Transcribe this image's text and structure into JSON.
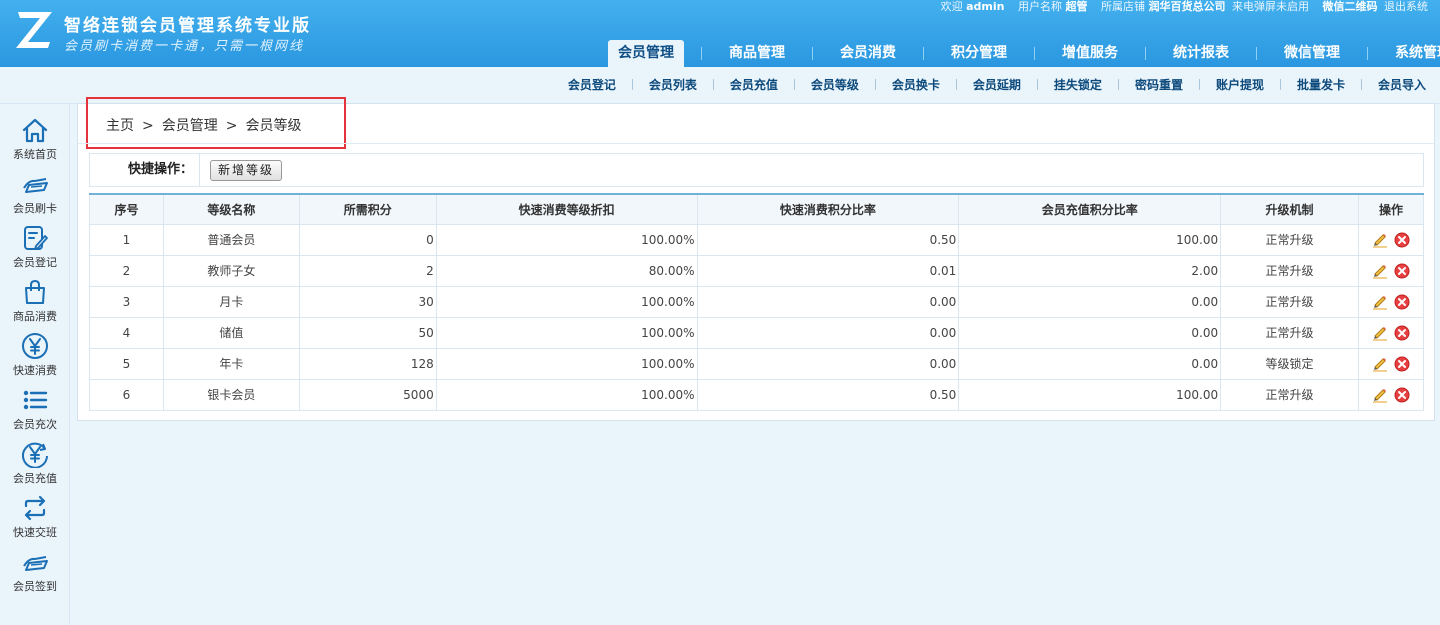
{
  "app": {
    "title": "智络连锁会员管理系统专业版",
    "slogan": "会员刷卡消费一卡通，只需一根网线"
  },
  "user_bar": {
    "welcome": "欢迎",
    "username": "admin",
    "user_name_label": "用户名称",
    "user_role": "超管",
    "store_label": "所属店铺",
    "store_name": "润华百货总公司",
    "popup_status": "来电弹屏未启用",
    "wechat_qr": "微信二维码",
    "logout": "退出系统"
  },
  "main_nav": [
    {
      "label": "会员管理",
      "active": true
    },
    {
      "label": "商品管理",
      "active": false
    },
    {
      "label": "会员消费",
      "active": false
    },
    {
      "label": "积分管理",
      "active": false
    },
    {
      "label": "增值服务",
      "active": false
    },
    {
      "label": "统计报表",
      "active": false
    },
    {
      "label": "微信管理",
      "active": false
    },
    {
      "label": "系统管理",
      "active": false
    }
  ],
  "sub_nav": [
    "会员登记",
    "会员列表",
    "会员充值",
    "会员等级",
    "会员换卡",
    "会员延期",
    "挂失锁定",
    "密码重置",
    "账户提现",
    "批量发卡",
    "会员导入"
  ],
  "sidebar": [
    {
      "label": "系统首页",
      "icon": "home-icon"
    },
    {
      "label": "会员刷卡",
      "icon": "card-swipe-icon"
    },
    {
      "label": "会员登记",
      "icon": "register-icon"
    },
    {
      "label": "商品消费",
      "icon": "shopping-bag-icon"
    },
    {
      "label": "快速消费",
      "icon": "yen-circle-icon"
    },
    {
      "label": "会员充次",
      "icon": "list-icon"
    },
    {
      "label": "会员充值",
      "icon": "yen-recharge-icon"
    },
    {
      "label": "快速交班",
      "icon": "swap-icon"
    },
    {
      "label": "会员签到",
      "icon": "card-swipe-icon"
    }
  ],
  "breadcrumb": [
    "主页",
    "会员管理",
    "会员等级"
  ],
  "breadcrumb_sep": ">",
  "quick_actions": {
    "label": "快捷操作：",
    "add_button": "新增等级"
  },
  "table": {
    "headers": [
      "序号",
      "等级名称",
      "所需积分",
      "快速消费等级折扣",
      "快速消费积分比率",
      "会员充值积分比率",
      "升级机制",
      "操作"
    ],
    "rows": [
      [
        "1",
        "普通会员",
        "0",
        "100.00%",
        "0.50",
        "100.00",
        "正常升级"
      ],
      [
        "2",
        "教师子女",
        "2",
        "80.00%",
        "0.01",
        "2.00",
        "正常升级"
      ],
      [
        "3",
        "月卡",
        "30",
        "100.00%",
        "0.00",
        "0.00",
        "正常升级"
      ],
      [
        "4",
        "储值",
        "50",
        "100.00%",
        "0.00",
        "0.00",
        "正常升级"
      ],
      [
        "5",
        "年卡",
        "128",
        "100.00%",
        "0.00",
        "0.00",
        "等级锁定"
      ],
      [
        "6",
        "银卡会员",
        "5000",
        "100.00%",
        "0.50",
        "100.00",
        "正常升级"
      ]
    ]
  },
  "colors": {
    "header_blue": "#2a97e0",
    "nav_text_dark": "#0d4a7c",
    "highlight_red": "#e5333c",
    "table_border_top": "#6fb1d8",
    "delete_red": "#e84040",
    "edit_orange": "#e6a020"
  }
}
